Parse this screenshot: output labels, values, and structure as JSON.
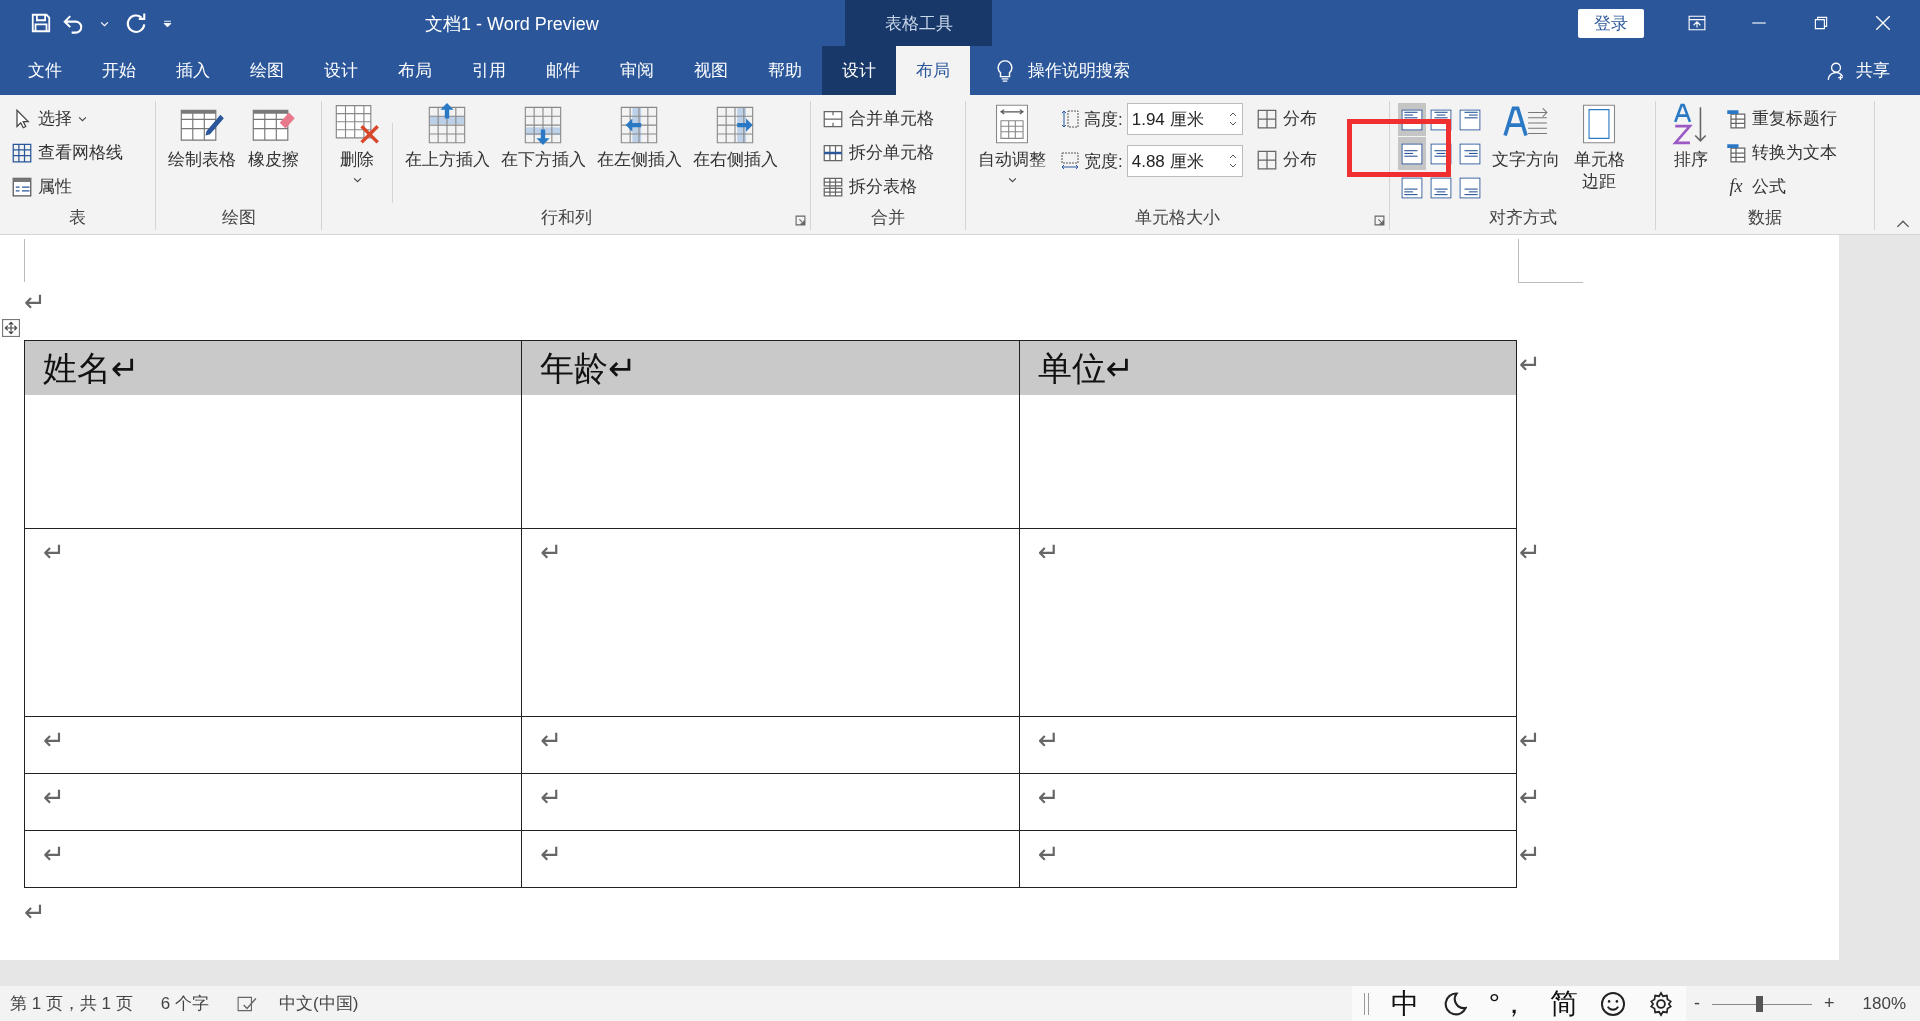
{
  "title_bar": {
    "title": "文档1  -  Word Preview",
    "context_label": "表格工具",
    "login": "登录"
  },
  "tabs": [
    {
      "label": "文件",
      "selected": false,
      "contextual": false
    },
    {
      "label": "开始",
      "selected": false,
      "contextual": false
    },
    {
      "label": "插入",
      "selected": false,
      "contextual": false
    },
    {
      "label": "绘图",
      "selected": false,
      "contextual": false
    },
    {
      "label": "设计",
      "selected": false,
      "contextual": false
    },
    {
      "label": "布局",
      "selected": false,
      "contextual": false
    },
    {
      "label": "引用",
      "selected": false,
      "contextual": false
    },
    {
      "label": "邮件",
      "selected": false,
      "contextual": false
    },
    {
      "label": "审阅",
      "selected": false,
      "contextual": false
    },
    {
      "label": "视图",
      "selected": false,
      "contextual": false
    },
    {
      "label": "帮助",
      "selected": false,
      "contextual": false
    },
    {
      "label": "设计",
      "selected": false,
      "contextual": true
    },
    {
      "label": "布局",
      "selected": true,
      "contextual": true
    }
  ],
  "tell_me": "操作说明搜索",
  "share": "共享",
  "ribbon": {
    "table": {
      "label": "表",
      "buttons": [
        {
          "label": "选择",
          "dropdown": true
        },
        {
          "label": "查看网格线",
          "dropdown": false
        },
        {
          "label": "属性",
          "dropdown": false
        }
      ]
    },
    "draw": {
      "label": "绘图",
      "buttons": [
        {
          "label": "绘制表格"
        },
        {
          "label": "橡皮擦"
        }
      ]
    },
    "rows_cols": {
      "label": "行和列",
      "delete": {
        "label": "删除",
        "dropdown": true
      },
      "inserts": [
        {
          "label": "在上方插入"
        },
        {
          "label": "在下方插入"
        },
        {
          "label": "在左侧插入"
        },
        {
          "label": "在右侧插入"
        }
      ]
    },
    "merge": {
      "label": "合并",
      "buttons": [
        {
          "label": "合并单元格"
        },
        {
          "label": "拆分单元格"
        },
        {
          "label": "拆分表格"
        }
      ]
    },
    "cell_size": {
      "label": "单元格大小",
      "autofit": {
        "label": "自动调整",
        "dropdown": true
      },
      "height": {
        "label": "高度:",
        "value": "1.94 厘米"
      },
      "width": {
        "label": "宽度:",
        "value": "4.88 厘米"
      },
      "distribute": [
        "分布",
        "分布"
      ]
    },
    "alignment": {
      "label": "对齐方式",
      "cells": [
        {
          "selected": true
        },
        {
          "selected": false
        },
        {
          "selected": false
        },
        {
          "selected": true
        },
        {
          "selected": false
        },
        {
          "selected": false
        },
        {
          "selected": false
        },
        {
          "selected": false
        },
        {
          "selected": false
        }
      ],
      "text_direction": "文字方向",
      "margins": "单元格边距"
    },
    "data": {
      "label": "数据",
      "sort": "排序",
      "buttons": [
        {
          "label": "重复标题行"
        },
        {
          "label": "转换为文本"
        },
        {
          "label": "公式",
          "icon_text": "fx"
        }
      ]
    }
  },
  "document": {
    "before_mark": "↵",
    "after_mark": "↵",
    "rows": [
      {
        "shaded": true,
        "cells": [
          "姓名↵",
          "年龄↵",
          "单位↵"
        ],
        "end_mark": "↵"
      },
      {
        "shaded": false,
        "cells": [
          "↵",
          "↵",
          "↵"
        ],
        "end_mark": "↵"
      },
      {
        "shaded": false,
        "cells": [
          "↵",
          "↵",
          "↵"
        ],
        "end_mark": "↵"
      },
      {
        "shaded": false,
        "cells": [
          "↵",
          "↵",
          "↵"
        ],
        "end_mark": "↵"
      },
      {
        "shaded": false,
        "cells": [
          "↵",
          "↵",
          "↵"
        ],
        "end_mark": "↵"
      }
    ]
  },
  "status_bar": {
    "page": "第 1 页，共 1 页",
    "words": "6 个字",
    "language": "中文(中国)",
    "ime": [
      "中",
      "°，",
      "简"
    ],
    "zoom_minus": "-",
    "zoom_plus": "+",
    "zoom": {
      "level": 0.47,
      "reading": "180%"
    }
  }
}
